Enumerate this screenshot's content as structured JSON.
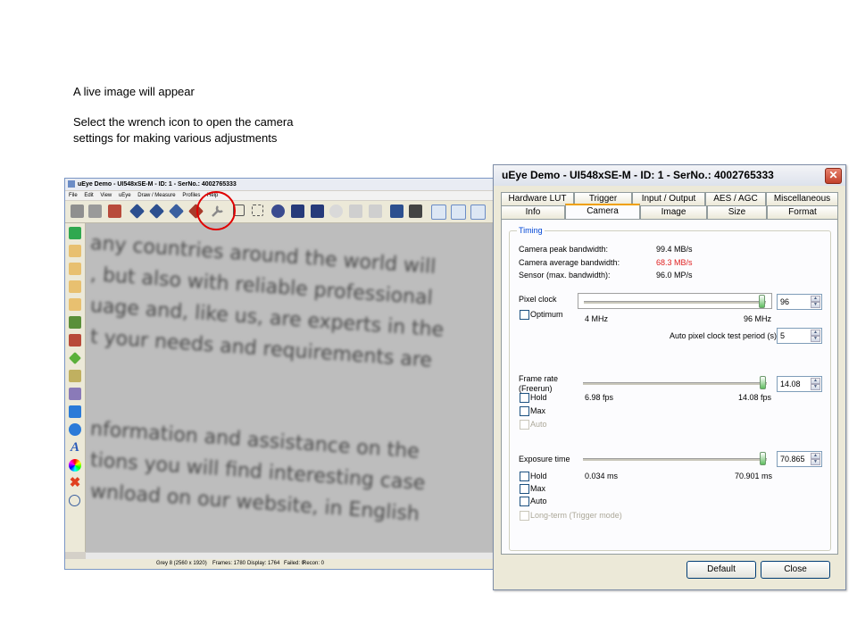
{
  "instructions": {
    "line1": "A live image will appear",
    "line2": "Select the wrench icon to open the camera",
    "line3": "settings for making various adjustments"
  },
  "app": {
    "title": "uEye Demo - UI548xSE-M - ID: 1 - SerNo.: 4002765333",
    "menu": [
      "File",
      "Edit",
      "View",
      "uEye",
      "Draw / Measure",
      "Profiles",
      "Help"
    ],
    "canvas_text": [
      "any countries around the world will",
      ", but also with reliable professional",
      "uage and, like us, are experts in the",
      "t your needs and requirements are",
      "",
      "nformation and assistance on the",
      "tions you will find interesting case",
      "wnload on our website, in English"
    ],
    "status": {
      "format": "Grey 8 (2560 x 1920)",
      "frames": "Frames: 1780",
      "display": "Display: 1764",
      "failed": "Failed: 0",
      "recon": "Recon: 0"
    },
    "highlight_color": "#e00000"
  },
  "dialog": {
    "title": "uEye Demo - UI548xSE-M - ID: 1 - SerNo.: 4002765333",
    "close_glyph": "✕",
    "tabs_row1": [
      "Hardware LUT",
      "Trigger",
      "Input / Output",
      "AES / AGC",
      "Miscellaneous"
    ],
    "tabs_row2": [
      "Info",
      "Camera",
      "Image",
      "Size",
      "Format"
    ],
    "active_tab": "Camera",
    "group_title": "Timing",
    "bandwidth": [
      {
        "label": "Camera peak bandwidth:",
        "value": "99.4 MB/s",
        "color": "#000000"
      },
      {
        "label": "Camera average bandwidth:",
        "value": "68.3 MB/s",
        "color": "#e02020"
      },
      {
        "label": "Sensor (max. bandwidth):",
        "value": "96.0 MP/s",
        "color": "#000000"
      }
    ],
    "pixel_clock": {
      "label": "Pixel clock",
      "value": "96",
      "min": "4 MHz",
      "max": "96 MHz",
      "slider_fraction": 1.0,
      "optimum_label": "Optimum",
      "test_period_label": "Auto pixel clock test period (s)",
      "test_period_value": "5"
    },
    "frame_rate": {
      "label1": "Frame rate",
      "label2": "(Freerun)",
      "value": "14.08",
      "min": "6.98 fps",
      "max": "14.08 fps",
      "slider_fraction": 1.0,
      "hold_label": "Hold",
      "max_label": "Max",
      "auto_label": "Auto"
    },
    "exposure": {
      "label": "Exposure time",
      "value": "70.865",
      "min": "0.034 ms",
      "max": "70.901 ms",
      "slider_fraction": 1.0,
      "hold_label": "Hold",
      "max_label": "Max",
      "auto_label": "Auto",
      "longterm_label": "Long-term (Trigger mode)"
    },
    "buttons": {
      "default": "Default",
      "close": "Close"
    }
  }
}
